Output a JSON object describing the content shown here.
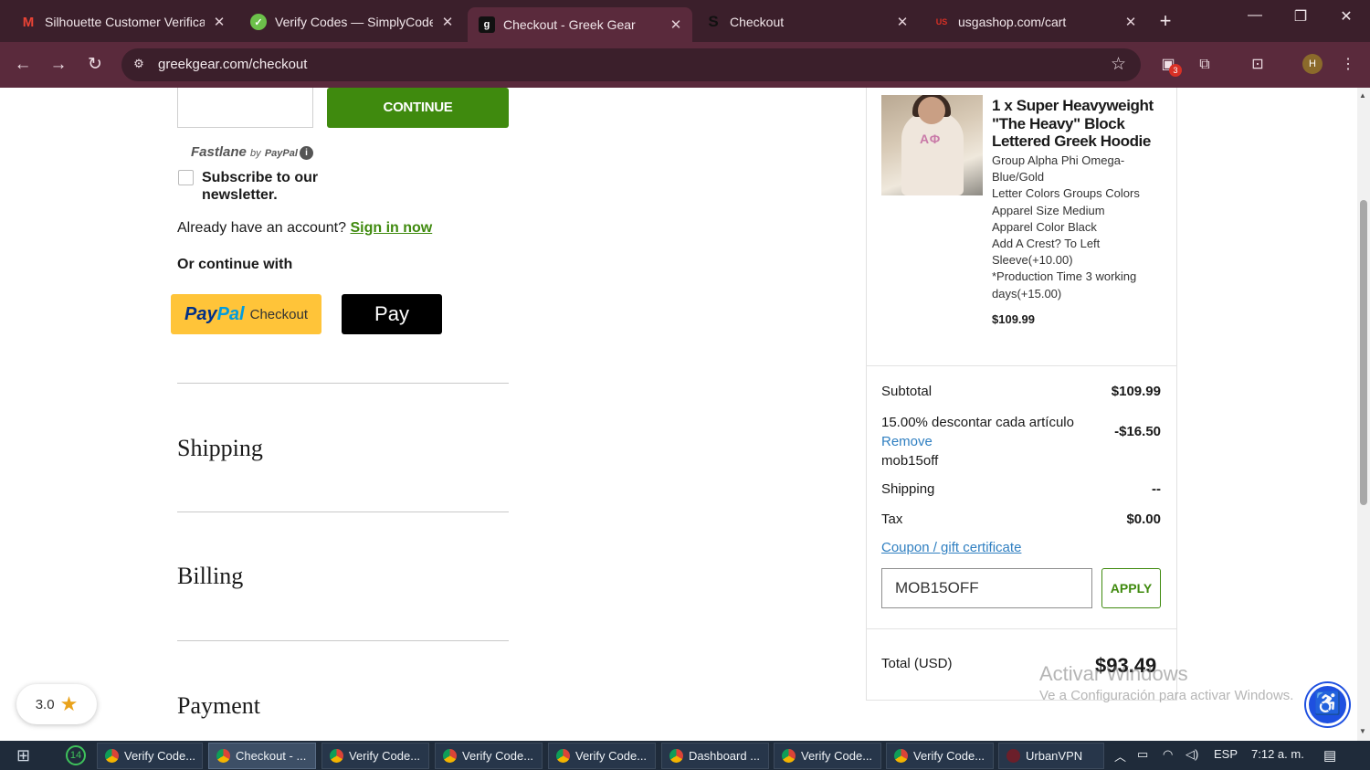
{
  "browser": {
    "tabs": [
      {
        "title": "Silhouette Customer Verificat",
        "icon": "gmail-icon"
      },
      {
        "title": "Verify Codes — SimplyCodes",
        "icon": "simplycodes-icon"
      },
      {
        "title": "Checkout - Greek Gear",
        "icon": "greekgear-icon",
        "active": true
      },
      {
        "title": "Checkout",
        "icon": "s-icon"
      },
      {
        "title": "usgashop.com/cart",
        "icon": "usga-icon"
      }
    ],
    "url": "greekgear.com/checkout",
    "extension_badge": "3",
    "profile_initial": "H"
  },
  "checkout": {
    "continue_label": "CONTINUE",
    "fastlane_label": "Fastlane",
    "fastlane_by": "by",
    "fastlane_paypal": "PayPal",
    "subscribe_label": "Subscribe to our newsletter.",
    "already_text": "Already have an account?",
    "signin_label": "Sign in now",
    "or_continue": "Or continue with",
    "paypal_logo_a": "Pay",
    "paypal_logo_b": "Pal",
    "paypal_text": "Checkout",
    "applepay_label": " Pay",
    "sections": {
      "shipping": "Shipping",
      "billing": "Billing",
      "payment": "Payment"
    }
  },
  "summary": {
    "product_name": "1 x Super Heavyweight \"The Heavy\" Block Lettered Greek Hoodie",
    "product_options": [
      "Group Alpha Phi Omega-Blue/Gold",
      "Letter Colors Groups Colors",
      "Apparel Size Medium",
      "Apparel Color Black",
      "Add A Crest? To Left Sleeve(+10.00)",
      "*Production Time 3 working days(+15.00)"
    ],
    "product_letters": "ΑΦ",
    "product_price": "$109.99",
    "subtotal_label": "Subtotal",
    "subtotal_value": "$109.99",
    "discount_label": "15.00% descontar cada artículo",
    "discount_value": "-$16.50",
    "remove_label": "Remove",
    "discount_code": "mob15off",
    "shipping_label": "Shipping",
    "shipping_value": "--",
    "tax_label": "Tax",
    "tax_value": "$0.00",
    "coupon_link": "Coupon / gift certificate",
    "coupon_value": "MOB15OFF",
    "apply_label": "APPLY",
    "total_label": "Total (USD)",
    "total_value": "$93.49"
  },
  "overlay": {
    "rating_value": "3.0",
    "watermark_title": "Activar Windows",
    "watermark_sub": "Ve a Configuración para activar Windows."
  },
  "taskbar": {
    "whatsapp_badge": "14",
    "items": [
      {
        "label": "Verify Code..."
      },
      {
        "label": "Checkout - ...",
        "active": true
      },
      {
        "label": "Verify Code..."
      },
      {
        "label": "Verify Code..."
      },
      {
        "label": "Verify Code..."
      },
      {
        "label": "Dashboard ..."
      },
      {
        "label": "Verify Code..."
      },
      {
        "label": "Verify Code..."
      },
      {
        "label": "UrbanVPN"
      }
    ],
    "language": "ESP",
    "time": "7:12 a. m."
  },
  "colors": {
    "tabbar": "#3b1f2b",
    "toolbar": "#5a2a3c",
    "brand_green": "#3f8a0e",
    "link_blue": "#2f7fc1",
    "paypal_yellow": "#ffc439",
    "accessibility_blue": "#1e50e0",
    "taskbar": "#1f2b3a"
  }
}
